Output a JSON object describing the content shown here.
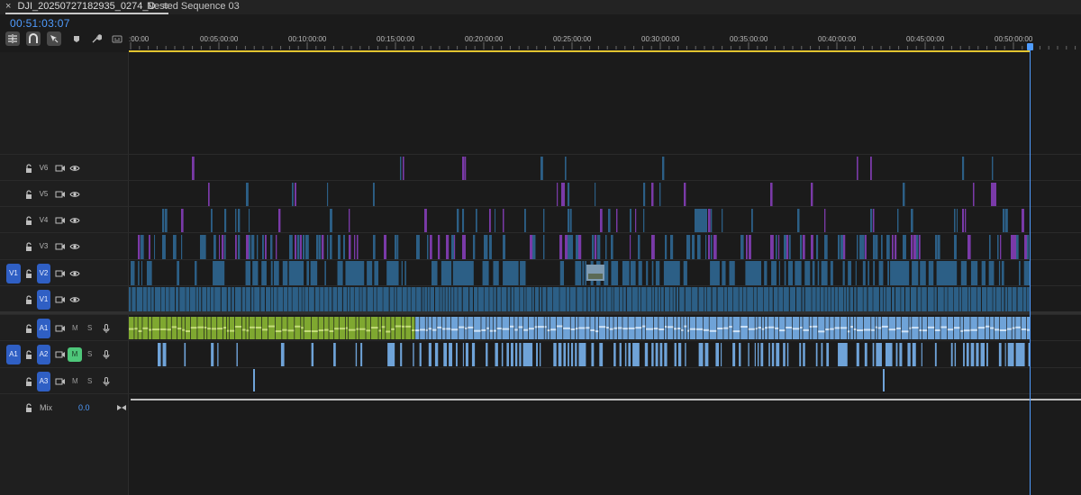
{
  "tabs": [
    {
      "label": "DJI_20250727182935_0274_D",
      "active": true
    },
    {
      "label": "Nested Sequence 03",
      "active": false
    }
  ],
  "timecode": "00:51:03:07",
  "toolbar": [
    "nest-toggle",
    "snap",
    "linked-selection",
    "add-marker",
    "timeline-settings",
    "captions"
  ],
  "ruler": {
    "labels": [
      ":00:00",
      "00:05:00:00",
      "00:10:00:00",
      "00:15:00:00",
      "00:20:00:00",
      "00:25:00:00",
      "00:30:00:00",
      "00:35:00:00",
      "00:40:00:00",
      "00:45:00:00",
      "00:50:00:00"
    ]
  },
  "tracks": {
    "video": [
      {
        "name": "V6",
        "source": ""
      },
      {
        "name": "V5",
        "source": ""
      },
      {
        "name": "V4",
        "source": ""
      },
      {
        "name": "V3",
        "source": ""
      },
      {
        "name": "V2",
        "source": "V1"
      },
      {
        "name": "V1",
        "source": ""
      }
    ],
    "audio": [
      {
        "name": "A1",
        "source": "",
        "m": "M",
        "s": "S",
        "muted": false
      },
      {
        "name": "A2",
        "source": "A1",
        "m": "M",
        "s": "S",
        "muted": true
      },
      {
        "name": "A3",
        "source": "",
        "m": "M",
        "s": "S",
        "muted": false
      }
    ],
    "mix": {
      "label": "Mix",
      "value": "0.0"
    }
  },
  "colors": {
    "accent": "#4f9cff",
    "track_target": "#2f5fc4",
    "clip_video": "#2c5f86",
    "clip_adjust": "#7a3aa8",
    "clip_audio_linked": "#6fa3d8",
    "clip_audio_green": "#7fa830",
    "in_out_bar": "#e2c430",
    "muted": "#4ec77a"
  }
}
